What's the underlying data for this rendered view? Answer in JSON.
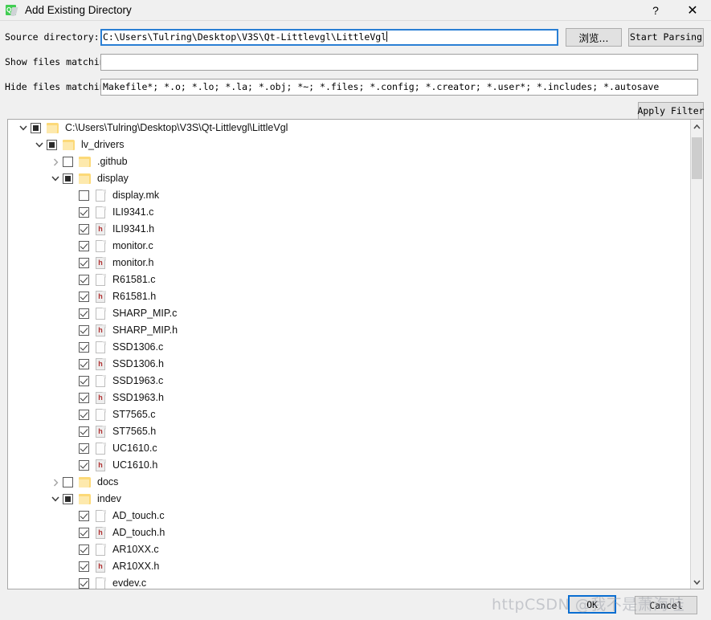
{
  "window": {
    "title": "Add Existing Directory",
    "icon": "qt-creator-icon",
    "icon_label": "Qt",
    "help_glyph": "?",
    "close_glyph": "✕"
  },
  "form": {
    "source_directory": {
      "label": "Source directory:",
      "value": "C:\\Users\\Tulring\\Desktop\\V3S\\Qt-Littlevgl\\LittleVgl",
      "placeholder": "",
      "focused": true
    },
    "show_files": {
      "label": "Show files matching:",
      "value": "",
      "placeholder": ""
    },
    "hide_files": {
      "label": "Hide files matching:",
      "value": "Makefile*; *.o; *.lo; *.la; *.obj; *~; *.files; *.config; *.creator; *.user*; *.includes; *.autosave",
      "placeholder": ""
    },
    "browse_button": "浏览...",
    "start_parsing_button": "Start Parsing",
    "apply_filter_button": "Apply Filter"
  },
  "tree": {
    "rows": [
      {
        "depth": 0,
        "arrow": "down",
        "check": "partial",
        "icon": "folder",
        "label": "C:\\Users\\Tulring\\Desktop\\V3S\\Qt-Littlevgl\\LittleVgl"
      },
      {
        "depth": 1,
        "arrow": "down",
        "check": "partial",
        "icon": "folder",
        "label": "lv_drivers"
      },
      {
        "depth": 2,
        "arrow": "right",
        "check": "unchecked",
        "icon": "folder",
        "label": ".github"
      },
      {
        "depth": 2,
        "arrow": "down",
        "check": "partial",
        "icon": "folder",
        "label": "display"
      },
      {
        "depth": 3,
        "arrow": "none",
        "check": "unchecked",
        "icon": "file",
        "label": "display.mk"
      },
      {
        "depth": 3,
        "arrow": "none",
        "check": "checked",
        "icon": "file",
        "label": "ILI9341.c"
      },
      {
        "depth": 3,
        "arrow": "none",
        "check": "checked",
        "icon": "header",
        "label": "ILI9341.h"
      },
      {
        "depth": 3,
        "arrow": "none",
        "check": "checked",
        "icon": "file",
        "label": "monitor.c"
      },
      {
        "depth": 3,
        "arrow": "none",
        "check": "checked",
        "icon": "header",
        "label": "monitor.h"
      },
      {
        "depth": 3,
        "arrow": "none",
        "check": "checked",
        "icon": "file",
        "label": "R61581.c"
      },
      {
        "depth": 3,
        "arrow": "none",
        "check": "checked",
        "icon": "header",
        "label": "R61581.h"
      },
      {
        "depth": 3,
        "arrow": "none",
        "check": "checked",
        "icon": "file",
        "label": "SHARP_MIP.c"
      },
      {
        "depth": 3,
        "arrow": "none",
        "check": "checked",
        "icon": "header",
        "label": "SHARP_MIP.h"
      },
      {
        "depth": 3,
        "arrow": "none",
        "check": "checked",
        "icon": "file",
        "label": "SSD1306.c"
      },
      {
        "depth": 3,
        "arrow": "none",
        "check": "checked",
        "icon": "header",
        "label": "SSD1306.h"
      },
      {
        "depth": 3,
        "arrow": "none",
        "check": "checked",
        "icon": "file",
        "label": "SSD1963.c"
      },
      {
        "depth": 3,
        "arrow": "none",
        "check": "checked",
        "icon": "header",
        "label": "SSD1963.h"
      },
      {
        "depth": 3,
        "arrow": "none",
        "check": "checked",
        "icon": "file",
        "label": "ST7565.c"
      },
      {
        "depth": 3,
        "arrow": "none",
        "check": "checked",
        "icon": "header",
        "label": "ST7565.h"
      },
      {
        "depth": 3,
        "arrow": "none",
        "check": "checked",
        "icon": "file",
        "label": "UC1610.c"
      },
      {
        "depth": 3,
        "arrow": "none",
        "check": "checked",
        "icon": "header",
        "label": "UC1610.h"
      },
      {
        "depth": 2,
        "arrow": "right",
        "check": "unchecked",
        "icon": "folder",
        "label": "docs"
      },
      {
        "depth": 2,
        "arrow": "down",
        "check": "partial",
        "icon": "folder",
        "label": "indev"
      },
      {
        "depth": 3,
        "arrow": "none",
        "check": "checked",
        "icon": "file",
        "label": "AD_touch.c"
      },
      {
        "depth": 3,
        "arrow": "none",
        "check": "checked",
        "icon": "header",
        "label": "AD_touch.h"
      },
      {
        "depth": 3,
        "arrow": "none",
        "check": "checked",
        "icon": "file",
        "label": "AR10XX.c"
      },
      {
        "depth": 3,
        "arrow": "none",
        "check": "checked",
        "icon": "header",
        "label": "AR10XX.h"
      },
      {
        "depth": 3,
        "arrow": "none",
        "check": "checked",
        "icon": "file",
        "label": "evdev.c"
      }
    ]
  },
  "scrollbar": {
    "up_glyph": "⌃",
    "down_glyph": "⌄"
  },
  "dialog_buttons": {
    "ok": "OK",
    "cancel": "Cancel"
  },
  "watermark": {
    "text": "httpCSDN @我不是萧海哇"
  },
  "colors": {
    "accent_focus": "#0a6ed1",
    "folder": "#fcd978",
    "header_letter": "#b03030",
    "window_bg": "#f0f0f0",
    "qt_green": "#41cd52"
  }
}
